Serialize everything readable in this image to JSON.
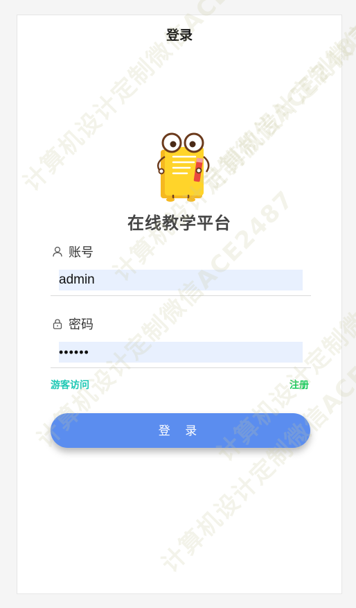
{
  "header": {
    "title": "登录"
  },
  "brand": {
    "app_title": "在线教学平台",
    "logo_icon": "book-mascot-icon"
  },
  "form": {
    "account": {
      "label": "账号",
      "icon": "user-icon",
      "value": "admin"
    },
    "password": {
      "label": "密码",
      "icon": "lock-icon",
      "value": "••••••"
    },
    "guest_link": "游客访问",
    "register_link": "注册",
    "login_button": "登 录"
  },
  "watermark": {
    "text": "计算机设计定制微信ACE2487"
  },
  "colors": {
    "accent": "#5b8def",
    "guest": "#1ec8b4",
    "register": "#19c95a",
    "input_bg": "#e8f0fe"
  }
}
